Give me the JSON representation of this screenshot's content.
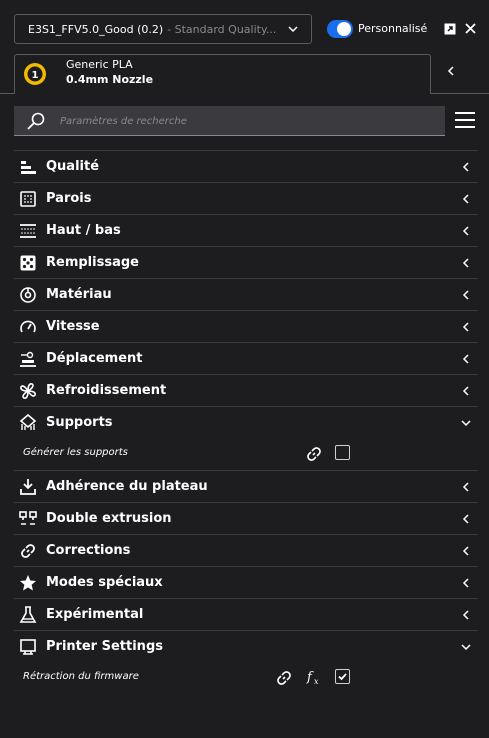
{
  "header": {
    "profile_name": "E3S1_FFV5.0_Good (0.2)",
    "profile_quality": "- Standard Quality...",
    "custom_label": "Personnalisé"
  },
  "material": {
    "extruder_number": "1",
    "name": "Generic PLA",
    "nozzle": "0.4mm Nozzle"
  },
  "search": {
    "placeholder": "Paramètres de recherche"
  },
  "categories": [
    {
      "label": "Qualité",
      "icon": "quality-icon",
      "expanded": false
    },
    {
      "label": "Parois",
      "icon": "walls-icon",
      "expanded": false
    },
    {
      "label": "Haut / bas",
      "icon": "top-bottom-icon",
      "expanded": false
    },
    {
      "label": "Remplissage",
      "icon": "infill-icon",
      "expanded": false
    },
    {
      "label": "Matériau",
      "icon": "material-icon",
      "expanded": false
    },
    {
      "label": "Vitesse",
      "icon": "speed-icon",
      "expanded": false
    },
    {
      "label": "Déplacement",
      "icon": "travel-icon",
      "expanded": false
    },
    {
      "label": "Refroidissement",
      "icon": "cooling-icon",
      "expanded": false
    },
    {
      "label": "Supports",
      "icon": "support-icon",
      "expanded": true
    },
    {
      "label": "Adhérence du plateau",
      "icon": "adhesion-icon",
      "expanded": false
    },
    {
      "label": "Double extrusion",
      "icon": "dual-extrusion-icon",
      "expanded": false
    },
    {
      "label": "Corrections",
      "icon": "fixes-icon",
      "expanded": false
    },
    {
      "label": "Modes spéciaux",
      "icon": "special-modes-icon",
      "expanded": false
    },
    {
      "label": "Expérimental",
      "icon": "experimental-icon",
      "expanded": false
    },
    {
      "label": "Printer Settings",
      "icon": "printer-settings-icon",
      "expanded": true
    }
  ],
  "settings": {
    "generate_support": {
      "label": "Générer les supports",
      "checked": false
    },
    "firmware_retraction": {
      "label": "Rétraction du firmware",
      "checked": true
    }
  },
  "colors": {
    "accent": "#196ef0",
    "background": "#1d1d1f",
    "search_bg": "#3b3b3f",
    "badge": "#f3ba00"
  }
}
